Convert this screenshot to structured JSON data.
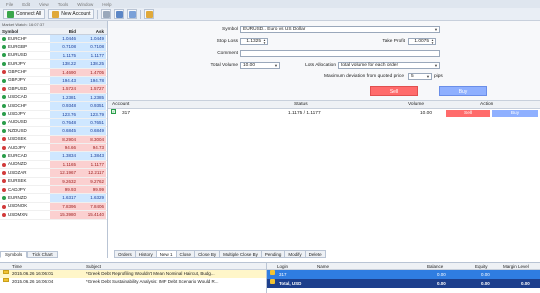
{
  "menu": [
    "File",
    "Edit",
    "View",
    "Tools",
    "Window",
    "Help"
  ],
  "toolbar": {
    "connect_all": "Connect All",
    "new_account": "New Account"
  },
  "market_watch": {
    "title": "Market Watch: 16:07:37",
    "headers": {
      "symbol": "Symbol",
      "bid": "Bid",
      "ask": "Ask"
    },
    "rows": [
      {
        "symbol": "EURCHF",
        "bid": "1.0446",
        "ask": "1.0449",
        "dir": "up"
      },
      {
        "symbol": "EURGBP",
        "bid": "0.7108",
        "ask": "0.7108",
        "dir": "up"
      },
      {
        "symbol": "EURUSD",
        "bid": "1.1175",
        "ask": "1.1177",
        "dir": "up"
      },
      {
        "symbol": "EURJPY",
        "bid": "138.22",
        "ask": "138.25",
        "dir": "up"
      },
      {
        "symbol": "GBPCHF",
        "bid": "1.4690",
        "ask": "1.4705",
        "dir": "down"
      },
      {
        "symbol": "GBPJPY",
        "bid": "194.43",
        "ask": "194.78",
        "dir": "up"
      },
      {
        "symbol": "GBPUSD",
        "bid": "1.5724",
        "ask": "1.5727",
        "dir": "down"
      },
      {
        "symbol": "USDCAD",
        "bid": "1.2381",
        "ask": "1.2385",
        "dir": "up"
      },
      {
        "symbol": "USDCHF",
        "bid": "0.9348",
        "ask": "0.9351",
        "dir": "up"
      },
      {
        "symbol": "USDJPY",
        "bid": "123.76",
        "ask": "123.79",
        "dir": "up"
      },
      {
        "symbol": "AUDUSD",
        "bid": "0.7648",
        "ask": "0.7651",
        "dir": "up"
      },
      {
        "symbol": "NZDUSD",
        "bid": "0.6845",
        "ask": "0.6849",
        "dir": "up"
      },
      {
        "symbol": "USDSEK",
        "bid": "8.2904",
        "ask": "8.3004",
        "dir": "down"
      },
      {
        "symbol": "AUDJPY",
        "bid": "94.66",
        "ask": "94.73",
        "dir": "down"
      },
      {
        "symbol": "EURCAD",
        "bid": "1.3834",
        "ask": "1.3843",
        "dir": "up"
      },
      {
        "symbol": "AUDNZD",
        "bid": "1.1165",
        "ask": "1.1177",
        "dir": "down"
      },
      {
        "symbol": "USDZAR",
        "bid": "12.1967",
        "ask": "12.2117",
        "dir": "down"
      },
      {
        "symbol": "EURSEK",
        "bid": "9.2632",
        "ask": "9.2762",
        "dir": "down"
      },
      {
        "symbol": "CADJPY",
        "bid": "99.93",
        "ask": "99.99",
        "dir": "down"
      },
      {
        "symbol": "EURNZD",
        "bid": "1.6317",
        "ask": "1.6329",
        "dir": "up"
      },
      {
        "symbol": "USDNOK",
        "bid": "7.8396",
        "ask": "7.8406",
        "dir": "down"
      },
      {
        "symbol": "USDMXN",
        "bid": "15.3980",
        "ask": "15.4140",
        "dir": "down"
      }
    ],
    "tabs": [
      "Symbols",
      "Tick Chart"
    ]
  },
  "order": {
    "symbol_label": "Symbol",
    "symbol_value": "EURUSD.. Euro vs US Dollar",
    "stop_loss_label": "Stop Loss",
    "stop_loss_value": "1.1325",
    "take_profit_label": "Take Profit",
    "take_profit_value": "1.0075",
    "comment_label": "Comment",
    "total_volume_label": "Total Volume",
    "total_volume_value": "10.00",
    "lots_allocation_label": "Lots Allocation",
    "lots_allocation_value": "total volume for each order",
    "deviation_label": "Maximum deviation from quoted price",
    "deviation_value": "5",
    "deviation_unit": "pips",
    "sell_label": "Sell",
    "buy_label": "Buy"
  },
  "grid": {
    "headers": {
      "account": "Account",
      "status": "Status",
      "volume": "Volume",
      "action": "Action"
    },
    "row": {
      "account": "317",
      "status": "1.1175 / 1.1177",
      "volume": "10.00",
      "sell": "Sell",
      "buy": "Buy"
    }
  },
  "terminal_tabs": [
    "Orders",
    "History",
    "New 1",
    "Close",
    "Close By",
    "Multiple Close By",
    "Pending",
    "Modify",
    "Delete"
  ],
  "news": {
    "headers": {
      "time": "Time",
      "subject": "Subject"
    },
    "rows": [
      {
        "time": "2015.06.26 16:06:01",
        "subject": "*Greek Debt Reprofiling Wouldn't Mean Nominal Haircut, Budg..."
      },
      {
        "time": "2015.06.26 16:06:04",
        "subject": "*Greek Debt Sustainability Analysis: IMF Debt Scenario Would R..."
      }
    ]
  },
  "accounts": {
    "headers": {
      "login": "Login",
      "name": "Name",
      "balance": "Balance",
      "equity": "Equity",
      "margin": "Margin Level"
    },
    "rows": [
      {
        "login": "317",
        "name": "",
        "balance": "0.00",
        "equity": "0.00",
        "margin": ""
      },
      {
        "login": "Total, USD",
        "name": "",
        "balance": "0.00",
        "equity": "0.00",
        "margin": "0.00"
      }
    ]
  },
  "colors": {
    "sell": "#ff6b6b",
    "buy": "#8fb0ff",
    "up_row": "#cfe7ff",
    "down_row": "#fbd0d0",
    "selected_account": "#2f7de1"
  }
}
